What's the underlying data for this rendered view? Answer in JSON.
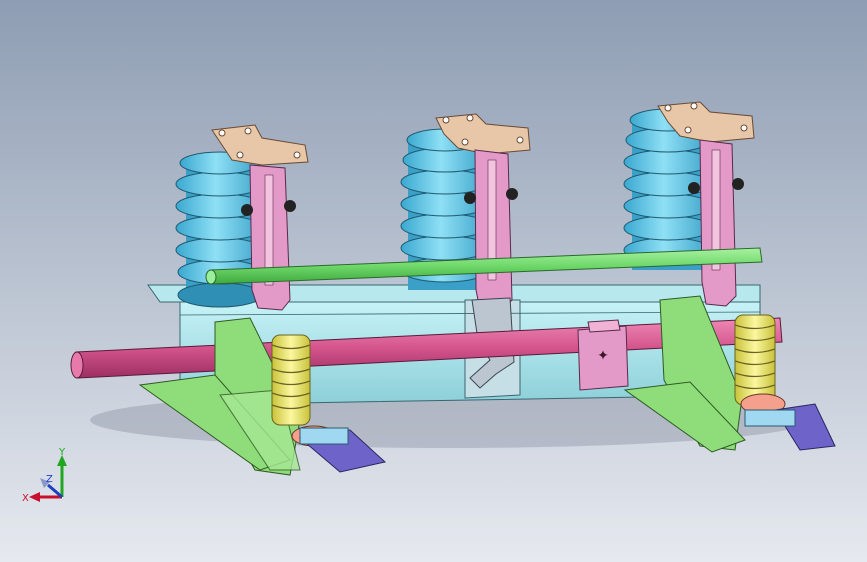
{
  "viewport": {
    "background_top": "#8e9db3",
    "background_bottom": "#e6e9ef"
  },
  "triad": {
    "x_label": "X",
    "y_label": "Y",
    "z_label": "Z",
    "x_color": "#c8102e",
    "y_color": "#1fa81f",
    "z_color": "#1f3fbf"
  },
  "model": {
    "insulator_color": "#5fc6e6",
    "terminal_color": "#e8c7a8",
    "frame_color": "#9fe0e6",
    "green_shaft_color": "#78e278",
    "magenta_shaft_color": "#d9568f",
    "bracket_color": "#8fdc7a",
    "spring_color": "#f0ec7a",
    "blade_color": "#e49ac9",
    "foot_color": "#6d63c9"
  }
}
